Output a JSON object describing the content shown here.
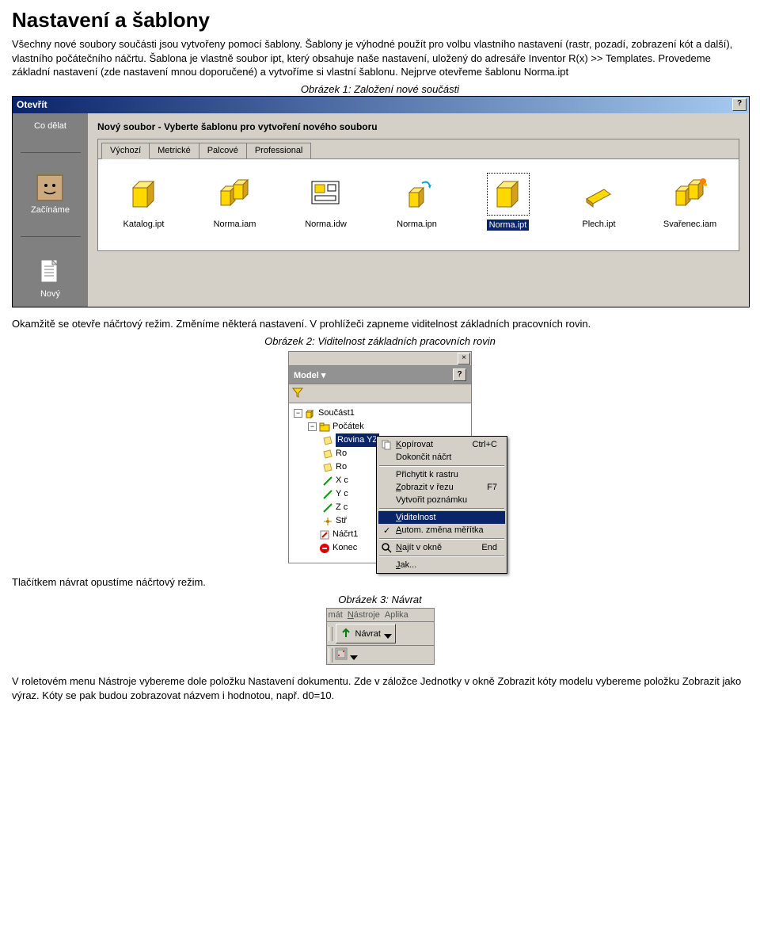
{
  "title": "Nastavení a šablony",
  "p1": "Všechny nové soubory součásti jsou vytvořeny pomocí šablony. Šablony je výhodné použít pro volbu vlastního nastavení (rastr, pozadí, zobrazení kót a další), vlastního počátečního náčrtu. Šablona je vlastně soubor ipt, který obsahuje naše nastavení, uložený do adresáře Inventor R(x) >> Templates. Provedeme základní nastavení (zde nastavení mnou doporučené) a vytvoříme si vlastní šablonu. Nejprve otevřeme šablonu Norma.ipt",
  "caption1": "Obrázek 1: Založení nové součásti",
  "dialog1": {
    "title": "Otevřít",
    "helpBtn": "?",
    "sidebar": {
      "item1": "Co dělat",
      "item2": "Začínáme",
      "item3": "Nový"
    },
    "panelTitle": "Nový soubor - Vyberte šablonu pro vytvoření nového souboru",
    "tabs": [
      "Výchozí",
      "Metrické",
      "Palcové",
      "Professional"
    ],
    "templates": [
      {
        "label": "Katalog.ipt"
      },
      {
        "label": "Norma.iam"
      },
      {
        "label": "Norma.idw"
      },
      {
        "label": "Norma.ipn"
      },
      {
        "label": "Norma.ipt"
      },
      {
        "label": "Plech.ipt"
      },
      {
        "label": "Svařenec.iam"
      }
    ]
  },
  "p2": "Okamžitě se otevře náčrtový režim. Změníme některá nastavení. V prohlížeči zapneme viditelnost základních pracovních rovin.",
  "caption2": "Obrázek 2: Viditelnost základních pracovních rovin",
  "panel2": {
    "modelLabel": "Model",
    "help": "?",
    "tree": {
      "root": "Součást1",
      "pocatek": "Počátek",
      "rovina": "Rovina YZ",
      "ro1": "Ro",
      "ro2": "Ro",
      "xc": "X c",
      "yc": "Y c",
      "zc": "Z c",
      "stred": "Stř",
      "nacrt": "Náčrt1",
      "konec": "Konec"
    },
    "menu": {
      "kopirovat": "Kopírovat",
      "kopirovat_sc": "Ctrl+C",
      "dokoncit": "Dokončit náčrt",
      "prichytit": "Přichytit k rastru",
      "zobrazit_rez": "Zobrazit v řezu",
      "zobrazit_rez_sc": "F7",
      "poznamka": "Vytvořit poznámku",
      "viditelnost": "Viditelnost",
      "autom": "Autom. změna měřítka",
      "najit": "Najít v okně",
      "najit_sc": "End",
      "jak": "Jak..."
    }
  },
  "p3": "Tlačítkem návrat opustíme náčrtový režim.",
  "caption3": "Obrázek 3: Návrat",
  "toolbar3": {
    "menu1": "mát",
    "menu2": "Nástroje",
    "menu3": "Aplika",
    "navrat": "Návrat"
  },
  "p4": "V roletovém menu Nástroje vybereme dole položku Nastavení dokumentu. Zde v záložce Jednotky v okně Zobrazit kóty modelu vybereme položku Zobrazit jako výraz. Kóty se pak budou zobrazovat názvem i hodnotou, např. d0=10."
}
